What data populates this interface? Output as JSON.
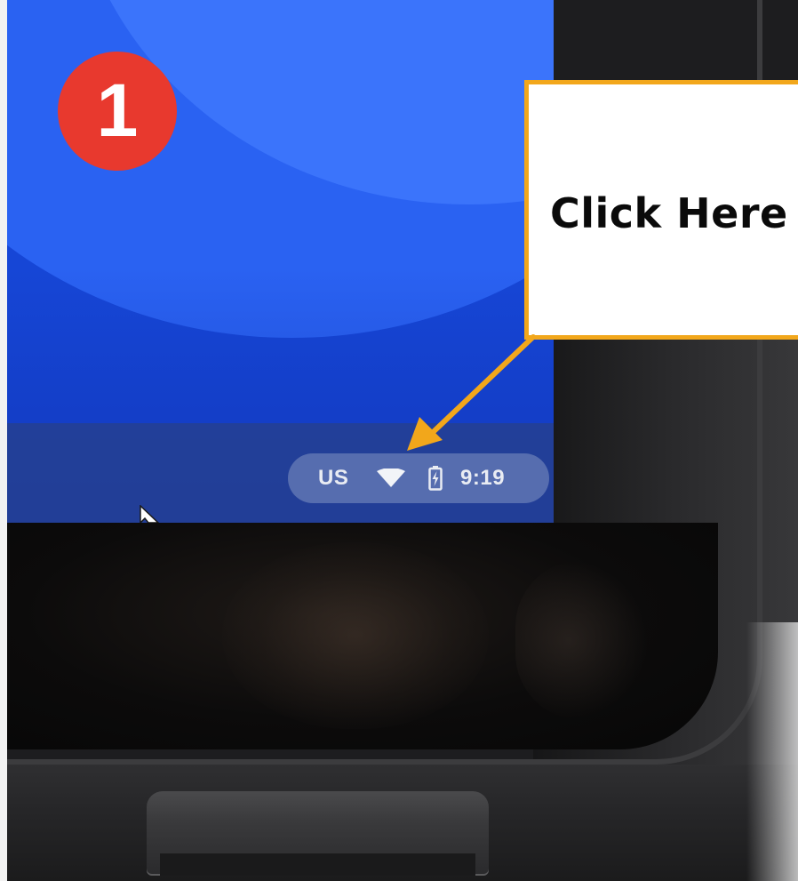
{
  "step_badge": {
    "number": "1",
    "color": "#e8392e"
  },
  "callout": {
    "text": "Click Here",
    "border_color": "#f2a71b"
  },
  "status_tray": {
    "input_method": "US",
    "wifi_icon": "wifi-icon",
    "battery_icon": "battery-charging-icon",
    "clock": "9:19"
  },
  "pointer": {
    "icon": "mouse-cursor-icon"
  },
  "colors": {
    "screen_blue": "#1646d6",
    "arrow": "#f2a71b",
    "bezel": "#1d1d1f"
  }
}
